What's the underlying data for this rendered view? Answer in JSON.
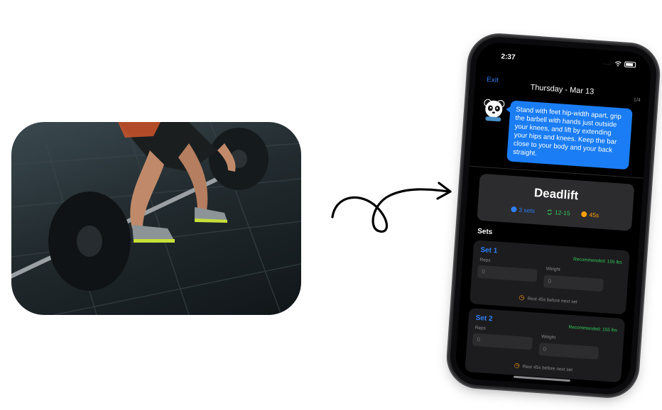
{
  "status_bar": {
    "time": "2:37",
    "signal": "...."
  },
  "nav": {
    "exit_label": "Exit",
    "title": "Thursday - Mar 13",
    "progress": "1/4"
  },
  "coach": {
    "avatar_icon": "panda-icon",
    "message": "Stand with feet hip-width apart, grip the barbell with hands just outside your knees, and lift by extending your hips and knees. Keep the bar close to your body and your back straight."
  },
  "exercise": {
    "name": "Deadlift",
    "sets": "3 sets",
    "reps": "12-15",
    "rest": "45s",
    "sets_icon": "set-count-icon",
    "reps_icon": "repeat-icon",
    "rest_icon": "timer-icon"
  },
  "sets_section": {
    "label": "Sets"
  },
  "sets": [
    {
      "title": "Set 1",
      "recommended": "Recommended: 155 lbs",
      "reps_label": "Reps",
      "reps_placeholder": "0",
      "weight_label": "Weight",
      "weight_placeholder": "0",
      "rest_note": "Rest 45s before next set"
    },
    {
      "title": "Set 2",
      "recommended": "Recommended: 155 lbs",
      "reps_label": "Reps",
      "reps_placeholder": "0",
      "weight_label": "Weight",
      "weight_placeholder": "0",
      "rest_note": "Rest 45s before next set"
    }
  ],
  "colors": {
    "accent_blue": "#2f7ff5",
    "green": "#33c759",
    "orange": "#ff9f0a",
    "card": "#2c2c2e"
  }
}
